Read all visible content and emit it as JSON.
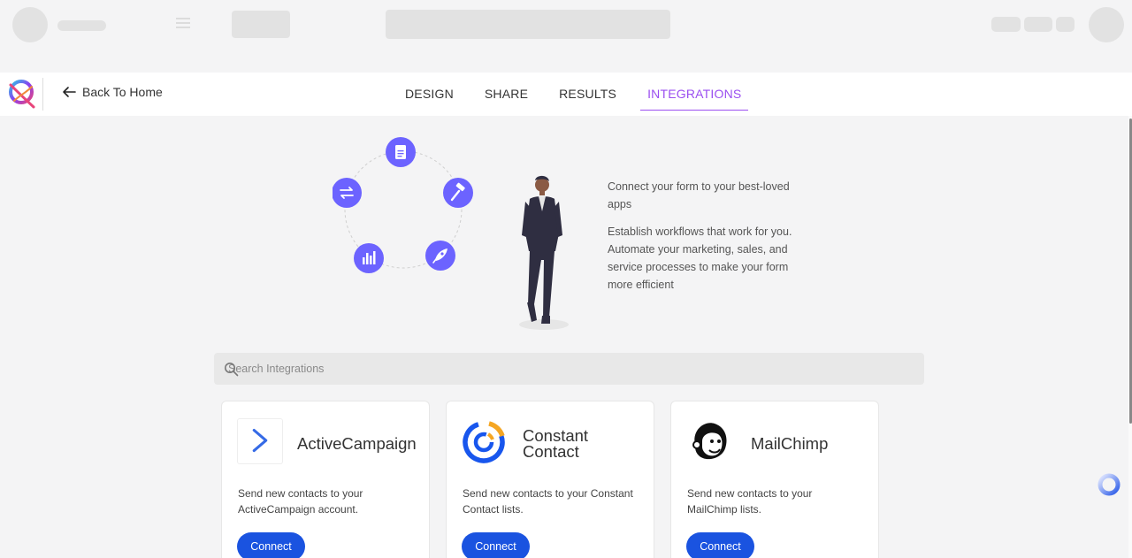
{
  "nav": {
    "back_label": "Back To Home",
    "tabs": [
      {
        "label": "DESIGN",
        "active": false
      },
      {
        "label": "SHARE",
        "active": false
      },
      {
        "label": "RESULTS",
        "active": false
      },
      {
        "label": "INTEGRATIONS",
        "active": true
      }
    ]
  },
  "hero": {
    "heading": "Connect your form to your best-loved apps",
    "body": "Establish workflows that work for you. Automate your marketing, sales, and service processes to make your form more efficient",
    "icons": [
      "document-icon",
      "hammer-icon",
      "rocket-icon",
      "chart-icon",
      "sync-icon"
    ]
  },
  "search": {
    "placeholder": "Search Integrations"
  },
  "integrations": [
    {
      "name": "ActiveCampaign",
      "description": "Send new contacts to your ActiveCampaign account.",
      "button": "Connect",
      "icon": "activecampaign-logo"
    },
    {
      "name_line1": "Constant",
      "name_line2": "Contact",
      "description": "Send new contacts to your Constant Contact lists.",
      "button": "Connect",
      "icon": "constant-contact-logo"
    },
    {
      "name": "MailChimp",
      "description": "Send new contacts to your MailChimp lists.",
      "button": "Connect",
      "icon": "mailchimp-logo"
    }
  ],
  "colors": {
    "accent": "#9b4ff0",
    "primary_button": "#1a53e0",
    "icon_bubble": "#6c63ff"
  }
}
